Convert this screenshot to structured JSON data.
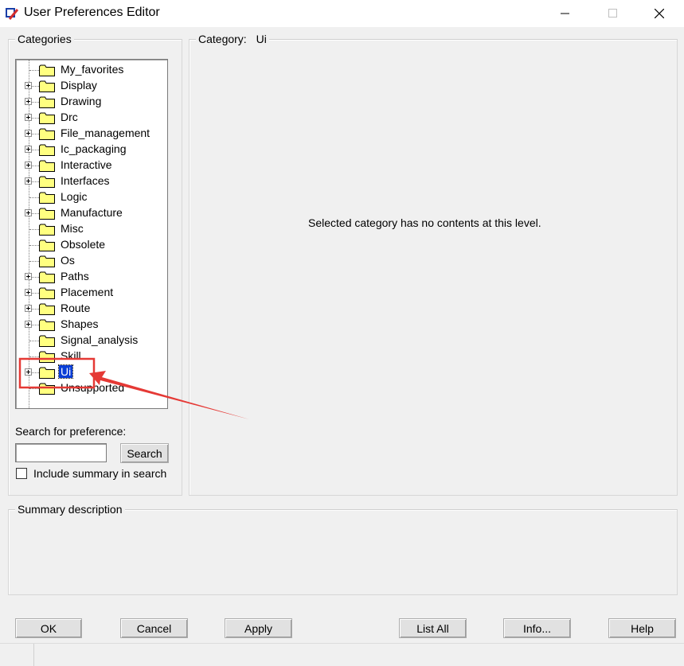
{
  "window": {
    "title": "User Preferences Editor"
  },
  "categories_panel": {
    "label": "Categories",
    "items": [
      {
        "label": "My_favorites",
        "expandable": false
      },
      {
        "label": "Display",
        "expandable": true
      },
      {
        "label": "Drawing",
        "expandable": true
      },
      {
        "label": "Drc",
        "expandable": true
      },
      {
        "label": "File_management",
        "expandable": true
      },
      {
        "label": "Ic_packaging",
        "expandable": true
      },
      {
        "label": "Interactive",
        "expandable": true
      },
      {
        "label": "Interfaces",
        "expandable": true
      },
      {
        "label": "Logic",
        "expandable": false
      },
      {
        "label": "Manufacture",
        "expandable": true
      },
      {
        "label": "Misc",
        "expandable": false
      },
      {
        "label": "Obsolete",
        "expandable": false
      },
      {
        "label": "Os",
        "expandable": false
      },
      {
        "label": "Paths",
        "expandable": true
      },
      {
        "label": "Placement",
        "expandable": true
      },
      {
        "label": "Route",
        "expandable": true
      },
      {
        "label": "Shapes",
        "expandable": true
      },
      {
        "label": "Signal_analysis",
        "expandable": false
      },
      {
        "label": "Skill",
        "expandable": false
      },
      {
        "label": "Ui",
        "expandable": true,
        "selected": true
      },
      {
        "label": "Unsupported",
        "expandable": false
      }
    ],
    "search_label": "Search for preference:",
    "search_value": "",
    "search_button": "Search",
    "include_summary_label": "Include summary in search",
    "include_summary_checked": false
  },
  "category_panel": {
    "label": "Category:",
    "value": "Ui",
    "message": "Selected category has no contents at this level."
  },
  "summary_panel": {
    "label": "Summary description"
  },
  "buttons": {
    "ok": "OK",
    "cancel": "Cancel",
    "apply": "Apply",
    "list_all": "List All",
    "info": "Info...",
    "help": "Help"
  },
  "annotation": {
    "highlight_color": "#e53935"
  },
  "colors": {
    "selection": "#0a3ed6",
    "folder": "#ffff80"
  }
}
